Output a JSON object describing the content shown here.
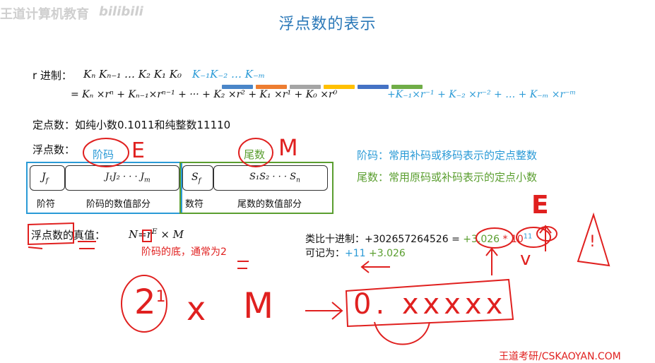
{
  "watermark": {
    "left_text": "王道计算机教育",
    "logo": "bilibili"
  },
  "title": "浮点数的表示",
  "colors": {
    "title": "#2a78b8",
    "blue": "#2a9ad6",
    "green": "#5a9e2f",
    "red": "#e0201f",
    "bars": [
      "#4a86c8",
      "#ed7d31",
      "#a5a5a5",
      "#ffc000",
      "#4472c4",
      "#70ad47"
    ]
  },
  "radix": {
    "label": "r 进制：",
    "digits_int": "Kₙ Kₙ₋₁ … K₂ K₁ K₀",
    "digits_frac": "K₋₁K₋₂ … K₋ₘ",
    "expansion_int": "= Kₙ ×rⁿ + Kₙ₋₁×rⁿ⁻¹ + ··· + K₂ ×r² + K₁ ×r¹ + K₀ ×r⁰",
    "expansion_frac": "+K₋₁×r⁻¹ + K₋₂ ×r⁻² + … + K₋ₘ ×r⁻ᵐ"
  },
  "fixed_point": "定点数：如纯小数0.1011和纯整数11110",
  "floating": {
    "label": "浮点数：",
    "exponent_tag": "阶码",
    "mantissa_tag": "尾数",
    "cells": {
      "jf": "J",
      "jf_sub": "f",
      "jbits": "J₁J₂ · · · J",
      "jbits_sub": "m",
      "sf": "S",
      "sf_sub": "f",
      "sbits": "S₁S₂ · · · S",
      "sbits_sub": "n"
    },
    "labels": {
      "exp_sign": "阶符",
      "exp_value": "阶码的数值部分",
      "man_sign": "数符",
      "man_value": "尾数的数值部分"
    }
  },
  "notes": {
    "exponent": "阶码：常用补码或移码表示的定点整数",
    "mantissa": "尾数：常用原码或补码表示的定点小数"
  },
  "true_value": {
    "label": "浮点数的真值：",
    "formula_n": "N=r",
    "formula_e": "E",
    "formula_rest": " × M",
    "base_note": "阶码的底，通常为2"
  },
  "analogy": {
    "line1_label": "类比十进制：+302657264526 = ",
    "line1_mant": "+3.026",
    "line1_op": " * 10",
    "line1_exp": "11",
    "line2_label": "可记为：",
    "line2_exp": "+11",
    "line2_mant": "+3.026"
  },
  "handwriting": {
    "e_near_exp": "E",
    "m_near_mant": "M",
    "e_near_power": "E",
    "base_expr": "2",
    "base_sup": "1",
    "times": "x",
    "m": "M",
    "arrow": "→",
    "fraction": "0. xxxxx",
    "check": "v",
    "warn": "!"
  },
  "footer": "王道考研/CSKAOYAN.COM"
}
